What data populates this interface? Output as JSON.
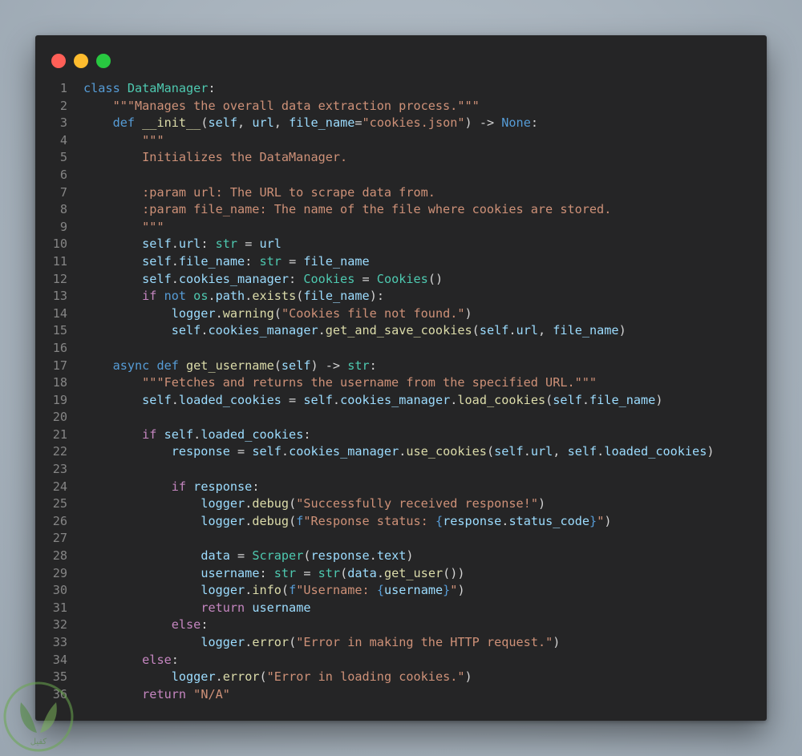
{
  "window": {
    "controls": [
      "close",
      "minimize",
      "maximize"
    ]
  },
  "code_lines": [
    {
      "n": "1",
      "tokens": [
        [
          "kw",
          "class "
        ],
        [
          "cls",
          "DataManager"
        ],
        [
          "pl",
          ":"
        ]
      ]
    },
    {
      "n": "2",
      "tokens": [
        [
          "pl",
          "    "
        ],
        [
          "str",
          "\"\"\"Manages the overall data extraction process.\"\"\""
        ]
      ]
    },
    {
      "n": "3",
      "tokens": [
        [
          "pl",
          "    "
        ],
        [
          "kw",
          "def "
        ],
        [
          "fn",
          "__init__"
        ],
        [
          "pl",
          "("
        ],
        [
          "var",
          "self"
        ],
        [
          "pl",
          ", "
        ],
        [
          "var",
          "url"
        ],
        [
          "pl",
          ", "
        ],
        [
          "var",
          "file_name"
        ],
        [
          "pl",
          "="
        ],
        [
          "str",
          "\"cookies.json\""
        ],
        [
          "pl",
          ") -> "
        ],
        [
          "kw",
          "None"
        ],
        [
          "pl",
          ":"
        ]
      ]
    },
    {
      "n": "4",
      "tokens": [
        [
          "pl",
          "        "
        ],
        [
          "str",
          "\"\"\""
        ]
      ]
    },
    {
      "n": "5",
      "tokens": [
        [
          "pl",
          "        "
        ],
        [
          "str",
          "Initializes the DataManager."
        ]
      ]
    },
    {
      "n": "6",
      "tokens": []
    },
    {
      "n": "7",
      "tokens": [
        [
          "pl",
          "        "
        ],
        [
          "str",
          ":param url: The URL to scrape data from."
        ]
      ]
    },
    {
      "n": "8",
      "tokens": [
        [
          "pl",
          "        "
        ],
        [
          "str",
          ":param file_name: The name of the file where cookies are stored."
        ]
      ]
    },
    {
      "n": "9",
      "tokens": [
        [
          "pl",
          "        "
        ],
        [
          "str",
          "\"\"\""
        ]
      ]
    },
    {
      "n": "10",
      "tokens": [
        [
          "pl",
          "        "
        ],
        [
          "var",
          "self"
        ],
        [
          "pl",
          "."
        ],
        [
          "var",
          "url"
        ],
        [
          "pl",
          ": "
        ],
        [
          "cls",
          "str"
        ],
        [
          "pl",
          " = "
        ],
        [
          "var",
          "url"
        ]
      ]
    },
    {
      "n": "11",
      "tokens": [
        [
          "pl",
          "        "
        ],
        [
          "var",
          "self"
        ],
        [
          "pl",
          "."
        ],
        [
          "var",
          "file_name"
        ],
        [
          "pl",
          ": "
        ],
        [
          "cls",
          "str"
        ],
        [
          "pl",
          " = "
        ],
        [
          "var",
          "file_name"
        ]
      ]
    },
    {
      "n": "12",
      "tokens": [
        [
          "pl",
          "        "
        ],
        [
          "var",
          "self"
        ],
        [
          "pl",
          "."
        ],
        [
          "var",
          "cookies_manager"
        ],
        [
          "pl",
          ": "
        ],
        [
          "cls",
          "Cookies"
        ],
        [
          "pl",
          " = "
        ],
        [
          "cls",
          "Cookies"
        ],
        [
          "pl",
          "()"
        ]
      ]
    },
    {
      "n": "13",
      "tokens": [
        [
          "pl",
          "        "
        ],
        [
          "ctl",
          "if "
        ],
        [
          "kw",
          "not "
        ],
        [
          "cls",
          "os"
        ],
        [
          "pl",
          "."
        ],
        [
          "var",
          "path"
        ],
        [
          "pl",
          "."
        ],
        [
          "fn",
          "exists"
        ],
        [
          "pl",
          "("
        ],
        [
          "var",
          "file_name"
        ],
        [
          "pl",
          "):"
        ]
      ]
    },
    {
      "n": "14",
      "tokens": [
        [
          "pl",
          "            "
        ],
        [
          "var",
          "logger"
        ],
        [
          "pl",
          "."
        ],
        [
          "fn",
          "warning"
        ],
        [
          "pl",
          "("
        ],
        [
          "str",
          "\"Cookies file not found.\""
        ],
        [
          "pl",
          ")"
        ]
      ]
    },
    {
      "n": "15",
      "tokens": [
        [
          "pl",
          "            "
        ],
        [
          "var",
          "self"
        ],
        [
          "pl",
          "."
        ],
        [
          "var",
          "cookies_manager"
        ],
        [
          "pl",
          "."
        ],
        [
          "fn",
          "get_and_save_cookies"
        ],
        [
          "pl",
          "("
        ],
        [
          "var",
          "self"
        ],
        [
          "pl",
          "."
        ],
        [
          "var",
          "url"
        ],
        [
          "pl",
          ", "
        ],
        [
          "var",
          "file_name"
        ],
        [
          "pl",
          ")"
        ]
      ]
    },
    {
      "n": "16",
      "tokens": []
    },
    {
      "n": "17",
      "tokens": [
        [
          "pl",
          "    "
        ],
        [
          "kw",
          "async def "
        ],
        [
          "fn",
          "get_username"
        ],
        [
          "pl",
          "("
        ],
        [
          "var",
          "self"
        ],
        [
          "pl",
          ") -> "
        ],
        [
          "cls",
          "str"
        ],
        [
          "pl",
          ":"
        ]
      ]
    },
    {
      "n": "18",
      "tokens": [
        [
          "pl",
          "        "
        ],
        [
          "str",
          "\"\"\"Fetches and returns the username from the specified URL.\"\"\""
        ]
      ]
    },
    {
      "n": "19",
      "tokens": [
        [
          "pl",
          "        "
        ],
        [
          "var",
          "self"
        ],
        [
          "pl",
          "."
        ],
        [
          "var",
          "loaded_cookies"
        ],
        [
          "pl",
          " = "
        ],
        [
          "var",
          "self"
        ],
        [
          "pl",
          "."
        ],
        [
          "var",
          "cookies_manager"
        ],
        [
          "pl",
          "."
        ],
        [
          "fn",
          "load_cookies"
        ],
        [
          "pl",
          "("
        ],
        [
          "var",
          "self"
        ],
        [
          "pl",
          "."
        ],
        [
          "var",
          "file_name"
        ],
        [
          "pl",
          ")"
        ]
      ]
    },
    {
      "n": "20",
      "tokens": []
    },
    {
      "n": "21",
      "tokens": [
        [
          "pl",
          "        "
        ],
        [
          "ctl",
          "if "
        ],
        [
          "var",
          "self"
        ],
        [
          "pl",
          "."
        ],
        [
          "var",
          "loaded_cookies"
        ],
        [
          "pl",
          ":"
        ]
      ]
    },
    {
      "n": "22",
      "tokens": [
        [
          "pl",
          "            "
        ],
        [
          "var",
          "response"
        ],
        [
          "pl",
          " = "
        ],
        [
          "var",
          "self"
        ],
        [
          "pl",
          "."
        ],
        [
          "var",
          "cookies_manager"
        ],
        [
          "pl",
          "."
        ],
        [
          "fn",
          "use_cookies"
        ],
        [
          "pl",
          "("
        ],
        [
          "var",
          "self"
        ],
        [
          "pl",
          "."
        ],
        [
          "var",
          "url"
        ],
        [
          "pl",
          ", "
        ],
        [
          "var",
          "self"
        ],
        [
          "pl",
          "."
        ],
        [
          "var",
          "loaded_cookies"
        ],
        [
          "pl",
          ")"
        ]
      ]
    },
    {
      "n": "23",
      "tokens": []
    },
    {
      "n": "24",
      "tokens": [
        [
          "pl",
          "            "
        ],
        [
          "ctl",
          "if "
        ],
        [
          "var",
          "response"
        ],
        [
          "pl",
          ":"
        ]
      ]
    },
    {
      "n": "25",
      "tokens": [
        [
          "pl",
          "                "
        ],
        [
          "var",
          "logger"
        ],
        [
          "pl",
          "."
        ],
        [
          "fn",
          "debug"
        ],
        [
          "pl",
          "("
        ],
        [
          "str",
          "\"Successfully received response!\""
        ],
        [
          "pl",
          ")"
        ]
      ]
    },
    {
      "n": "26",
      "tokens": [
        [
          "pl",
          "                "
        ],
        [
          "var",
          "logger"
        ],
        [
          "pl",
          "."
        ],
        [
          "fn",
          "debug"
        ],
        [
          "pl",
          "("
        ],
        [
          "kw",
          "f"
        ],
        [
          "str",
          "\"Response status: "
        ],
        [
          "brace",
          "{"
        ],
        [
          "var",
          "response"
        ],
        [
          "pl",
          "."
        ],
        [
          "var",
          "status_code"
        ],
        [
          "brace",
          "}"
        ],
        [
          "str",
          "\""
        ],
        [
          "pl",
          ")"
        ]
      ]
    },
    {
      "n": "27",
      "tokens": []
    },
    {
      "n": "28",
      "tokens": [
        [
          "pl",
          "                "
        ],
        [
          "var",
          "data"
        ],
        [
          "pl",
          " = "
        ],
        [
          "cls",
          "Scraper"
        ],
        [
          "pl",
          "("
        ],
        [
          "var",
          "response"
        ],
        [
          "pl",
          "."
        ],
        [
          "var",
          "text"
        ],
        [
          "pl",
          ")"
        ]
      ]
    },
    {
      "n": "29",
      "tokens": [
        [
          "pl",
          "                "
        ],
        [
          "var",
          "username"
        ],
        [
          "pl",
          ": "
        ],
        [
          "cls",
          "str"
        ],
        [
          "pl",
          " = "
        ],
        [
          "cls",
          "str"
        ],
        [
          "pl",
          "("
        ],
        [
          "var",
          "data"
        ],
        [
          "pl",
          "."
        ],
        [
          "fn",
          "get_user"
        ],
        [
          "pl",
          "())"
        ]
      ]
    },
    {
      "n": "30",
      "tokens": [
        [
          "pl",
          "                "
        ],
        [
          "var",
          "logger"
        ],
        [
          "pl",
          "."
        ],
        [
          "fn",
          "info"
        ],
        [
          "pl",
          "("
        ],
        [
          "kw",
          "f"
        ],
        [
          "str",
          "\"Username: "
        ],
        [
          "brace",
          "{"
        ],
        [
          "var",
          "username"
        ],
        [
          "brace",
          "}"
        ],
        [
          "str",
          "\""
        ],
        [
          "pl",
          ")"
        ]
      ]
    },
    {
      "n": "31",
      "tokens": [
        [
          "pl",
          "                "
        ],
        [
          "ctl",
          "return "
        ],
        [
          "var",
          "username"
        ]
      ]
    },
    {
      "n": "32",
      "tokens": [
        [
          "pl",
          "            "
        ],
        [
          "ctl",
          "else"
        ],
        [
          "pl",
          ":"
        ]
      ]
    },
    {
      "n": "33",
      "tokens": [
        [
          "pl",
          "                "
        ],
        [
          "var",
          "logger"
        ],
        [
          "pl",
          "."
        ],
        [
          "fn",
          "error"
        ],
        [
          "pl",
          "("
        ],
        [
          "str",
          "\"Error in making the HTTP request.\""
        ],
        [
          "pl",
          ")"
        ]
      ]
    },
    {
      "n": "34",
      "tokens": [
        [
          "pl",
          "        "
        ],
        [
          "ctl",
          "else"
        ],
        [
          "pl",
          ":"
        ]
      ]
    },
    {
      "n": "35",
      "tokens": [
        [
          "pl",
          "            "
        ],
        [
          "var",
          "logger"
        ],
        [
          "pl",
          "."
        ],
        [
          "fn",
          "error"
        ],
        [
          "pl",
          "("
        ],
        [
          "str",
          "\"Error in loading cookies.\""
        ],
        [
          "pl",
          ")"
        ]
      ]
    },
    {
      "n": "36",
      "tokens": [
        [
          "pl",
          "        "
        ],
        [
          "ctl",
          "return "
        ],
        [
          "str",
          "\"N/A\""
        ]
      ]
    }
  ],
  "watermark": {
    "text": "كفيل"
  }
}
